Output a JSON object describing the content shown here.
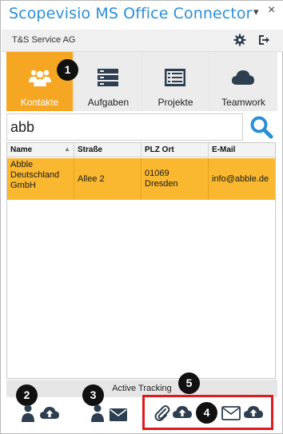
{
  "window": {
    "title": "Scopevisio MS Office Connector",
    "dropdown_glyph": "▾",
    "close_glyph": "×"
  },
  "company": {
    "name": "T&S Service AG"
  },
  "tabs": [
    {
      "label": "Kontakte",
      "icon": "contacts-icon",
      "active": true
    },
    {
      "label": "Aufgaben",
      "icon": "tasks-icon",
      "active": false
    },
    {
      "label": "Projekte",
      "icon": "projects-icon",
      "active": false
    },
    {
      "label": "Teamwork",
      "icon": "cloud-icon",
      "active": false
    }
  ],
  "search": {
    "value": "abb",
    "icon": "search-icon"
  },
  "table": {
    "headers": [
      "Name",
      "Straße",
      "PLZ Ort",
      "E-Mail"
    ],
    "rows": [
      {
        "name": "Abble Deutschland GmbH",
        "street": "Allee 2",
        "zip": "01069",
        "city": "Dresden",
        "email": "info@abble.de"
      }
    ]
  },
  "footer": {
    "status": "Active Tracking"
  },
  "callouts": [
    "1",
    "2",
    "3",
    "4",
    "5"
  ],
  "colors": {
    "accent": "#2b8fd6",
    "active_tab": "#f5a623",
    "selected_row": "#f9b830",
    "highlight": "#e0191c",
    "icon_dark": "#2c3e50"
  }
}
